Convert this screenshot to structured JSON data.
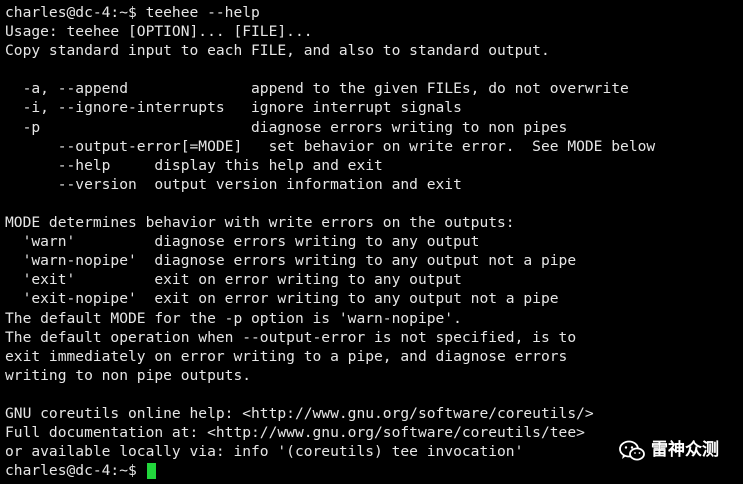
{
  "terminal": {
    "lines": [
      "charles@dc-4:~$ teehee --help",
      "Usage: teehee [OPTION]... [FILE]...",
      "Copy standard input to each FILE, and also to standard output.",
      "",
      "  -a, --append              append to the given FILEs, do not overwrite",
      "  -i, --ignore-interrupts   ignore interrupt signals",
      "  -p                        diagnose errors writing to non pipes",
      "      --output-error[=MODE]   set behavior on write error.  See MODE below",
      "      --help     display this help and exit",
      "      --version  output version information and exit",
      "",
      "MODE determines behavior with write errors on the outputs:",
      "  'warn'         diagnose errors writing to any output",
      "  'warn-nopipe'  diagnose errors writing to any output not a pipe",
      "  'exit'         exit on error writing to any output",
      "  'exit-nopipe'  exit on error writing to any output not a pipe",
      "The default MODE for the -p option is 'warn-nopipe'.",
      "The default operation when --output-error is not specified, is to",
      "exit immediately on error writing to a pipe, and diagnose errors",
      "writing to non pipe outputs.",
      "",
      "GNU coreutils online help: <http://www.gnu.org/software/coreutils/>",
      "Full documentation at: <http://www.gnu.org/software/coreutils/tee>",
      "or available locally via: info '(coreutils) tee invocation'"
    ],
    "prompt": "charles@dc-4:~$ ",
    "cursor_color": "#22d63c",
    "background": "#000000",
    "foreground": "#e6e6e6"
  },
  "watermark": {
    "text": "雷神众测",
    "icon": "wechat-icon"
  }
}
